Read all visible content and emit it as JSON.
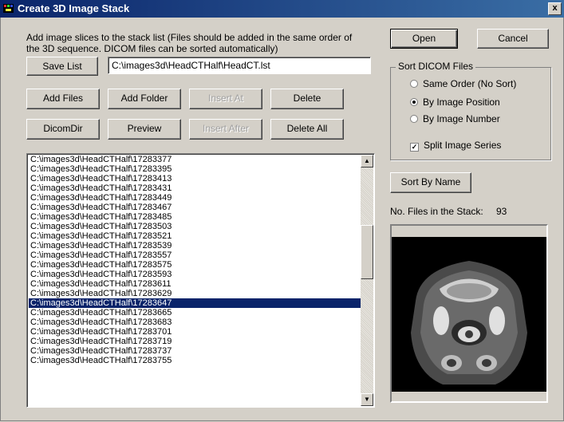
{
  "window": {
    "title": "Create 3D Image Stack",
    "close_glyph": "x"
  },
  "instructions": "Add image slices to the stack list (Files should be added in the same order of the 3D sequence. DICOM files can be sorted automatically)",
  "buttons": {
    "open": "Open",
    "cancel": "Cancel",
    "save_list": "Save List",
    "add_files": "Add Files",
    "add_folder": "Add Folder",
    "insert_at": "Insert At",
    "delete": "Delete",
    "dicomdir": "DicomDir",
    "preview": "Preview",
    "insert_after": "Insert After",
    "delete_all": "Delete All",
    "sort_by_name": "Sort By Name"
  },
  "save_path": "C:\\images3d\\HeadCTHalf\\HeadCT.lst",
  "sort_group": {
    "title": "Sort DICOM Files",
    "options": [
      {
        "label": "Same Order (No Sort)",
        "selected": false
      },
      {
        "label": "By Image Position",
        "selected": true
      },
      {
        "label": "By Image Number",
        "selected": false
      }
    ],
    "split_series": {
      "label": "Split Image Series",
      "checked": true
    }
  },
  "file_count": {
    "label": "No. Files in the Stack:",
    "value": "93"
  },
  "file_list": [
    "C:\\images3d\\HeadCTHalf\\17283377",
    "C:\\images3d\\HeadCTHalf\\17283395",
    "C:\\images3d\\HeadCTHalf\\17283413",
    "C:\\images3d\\HeadCTHalf\\17283431",
    "C:\\images3d\\HeadCTHalf\\17283449",
    "C:\\images3d\\HeadCTHalf\\17283467",
    "C:\\images3d\\HeadCTHalf\\17283485",
    "C:\\images3d\\HeadCTHalf\\17283503",
    "C:\\images3d\\HeadCTHalf\\17283521",
    "C:\\images3d\\HeadCTHalf\\17283539",
    "C:\\images3d\\HeadCTHalf\\17283557",
    "C:\\images3d\\HeadCTHalf\\17283575",
    "C:\\images3d\\HeadCTHalf\\17283593",
    "C:\\images3d\\HeadCTHalf\\17283611",
    "C:\\images3d\\HeadCTHalf\\17283629",
    "C:\\images3d\\HeadCTHalf\\17283647",
    "C:\\images3d\\HeadCTHalf\\17283665",
    "C:\\images3d\\HeadCTHalf\\17283683",
    "C:\\images3d\\HeadCTHalf\\17283701",
    "C:\\images3d\\HeadCTHalf\\17283719",
    "C:\\images3d\\HeadCTHalf\\17283737",
    "C:\\images3d\\HeadCTHalf\\17283755"
  ],
  "selected_index": 15,
  "scrollbar": {
    "up_glyph": "▲",
    "down_glyph": "▼"
  }
}
